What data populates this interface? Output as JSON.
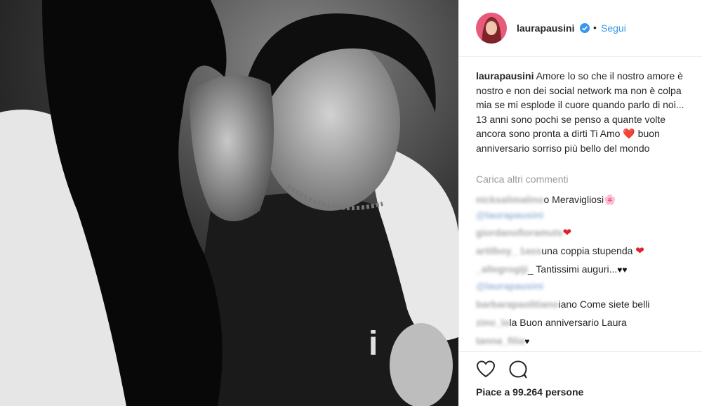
{
  "post": {
    "username": "laurapausini",
    "dot": "•",
    "follow_label": "Segui",
    "caption_user": "laurapausini",
    "caption_text": "Amore lo so che il nostro amore è nostro e non dei social network ma non è colpa mia se mi esplode il cuore quando parlo di noi... 13 anni sono pochi se penso a quante volte ancora sono pronta a dirti Ti Amo ❤️ buon anniversario sorriso più bello del mondo",
    "load_more": "Carica altri commenti",
    "likes_text": "Piace a 99.264 persone"
  },
  "comments": [
    {
      "user": "nicksalimalino",
      "text": "o Meravigliosi",
      "emoji": "🌸"
    },
    {
      "user": "@laurapausini",
      "text": "",
      "emoji": ""
    },
    {
      "user": "giordanofioramuts",
      "text": "",
      "emoji": "❤"
    },
    {
      "user": "artilboy_ 1ass",
      "text": "una coppia stupenda",
      "emoji": "❤"
    },
    {
      "user": "_allegrogiji",
      "text": "_ Tantissimi auguri...",
      "emoji": "♥♥"
    },
    {
      "user": "@laurapausini",
      "text": "",
      "emoji": ""
    },
    {
      "user": "barbarapaolitiano",
      "text": "iano Come siete belli",
      "emoji": ""
    },
    {
      "user": "zino_la",
      "text": "la Buon anniversario Laura",
      "emoji": ""
    },
    {
      "user": "tanna_filia",
      "text": "",
      "emoji": "♥"
    }
  ],
  "colors": {
    "link": "#3897f0",
    "verified": "#3897f0",
    "heart": "#e0202a",
    "muted": "#999999"
  },
  "icons": {
    "verified": "verified-badge-icon",
    "like": "heart-outline-icon",
    "comment": "speech-bubble-icon"
  }
}
